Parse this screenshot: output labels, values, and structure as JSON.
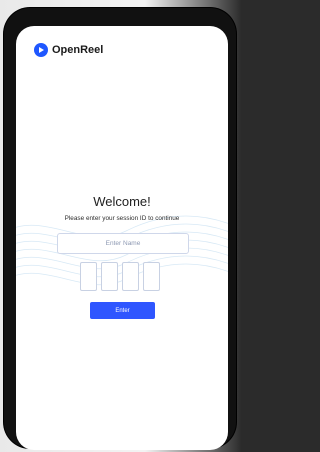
{
  "app": {
    "brand_name": "OpenReel",
    "accent_color": "#2f56ff"
  },
  "welcome": {
    "heading": "Welcome!",
    "subtitle": "Please enter your session ID to continue"
  },
  "form": {
    "name_placeholder": "Enter Name",
    "name_value": "",
    "session_code_boxes": [
      "",
      "",
      "",
      ""
    ],
    "enter_label": "Enter"
  }
}
